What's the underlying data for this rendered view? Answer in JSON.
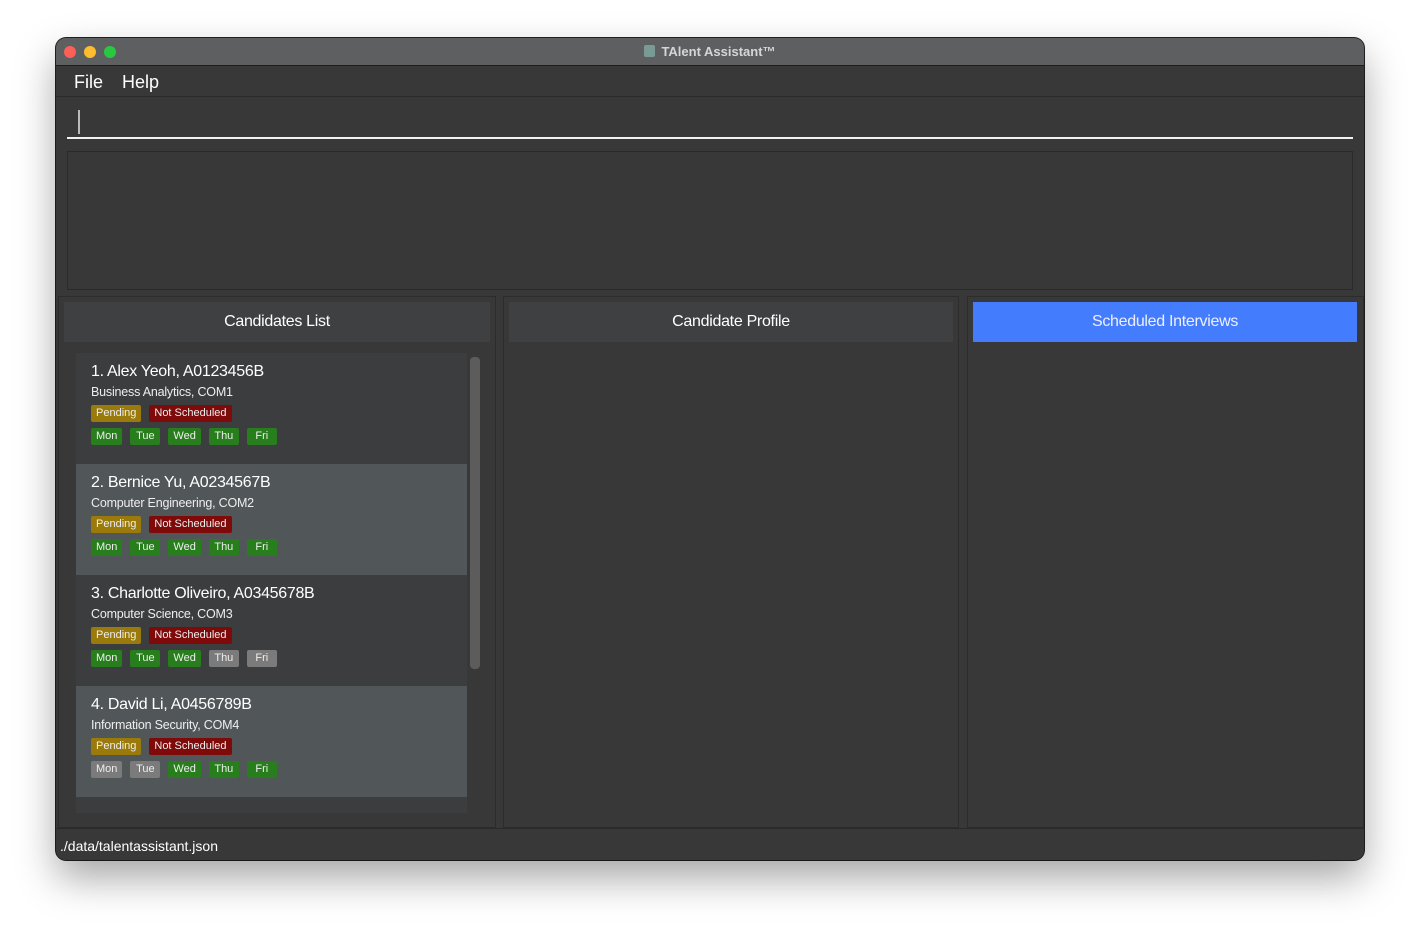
{
  "window": {
    "title": "TAlent Assistant™",
    "title_icon": "calendar-icon"
  },
  "menu": {
    "file": "File",
    "help": "Help"
  },
  "command": {
    "value": ""
  },
  "panels": {
    "candidates": "Candidates List",
    "profile": "Candidate Profile",
    "interviews": "Scheduled Interviews"
  },
  "colors": {
    "accent": "#437dfe",
    "pending": "#9a7a0a",
    "not_scheduled": "#7e0a0a",
    "available": "#287d1d",
    "unavailable": "#7b7b7b"
  },
  "candidates": [
    {
      "title": "1.  Alex Yeoh, A0123456B",
      "subtitle": "Business Analytics, COM1",
      "status": "Pending",
      "interview": "Not Scheduled",
      "days": [
        {
          "label": "Mon",
          "available": true
        },
        {
          "label": "Tue",
          "available": true
        },
        {
          "label": "Wed",
          "available": true
        },
        {
          "label": "Thu",
          "available": true
        },
        {
          "label": "Fri",
          "available": true
        }
      ]
    },
    {
      "title": "2.  Bernice Yu, A0234567B",
      "subtitle": "Computer Engineering, COM2",
      "status": "Pending",
      "interview": "Not Scheduled",
      "days": [
        {
          "label": "Mon",
          "available": true
        },
        {
          "label": "Tue",
          "available": true
        },
        {
          "label": "Wed",
          "available": true
        },
        {
          "label": "Thu",
          "available": true
        },
        {
          "label": "Fri",
          "available": true
        }
      ]
    },
    {
      "title": "3.  Charlotte Oliveiro, A0345678B",
      "subtitle": "Computer Science, COM3",
      "status": "Pending",
      "interview": "Not Scheduled",
      "days": [
        {
          "label": "Mon",
          "available": true
        },
        {
          "label": "Tue",
          "available": true
        },
        {
          "label": "Wed",
          "available": true
        },
        {
          "label": "Thu",
          "available": false
        },
        {
          "label": "Fri",
          "available": false
        }
      ]
    },
    {
      "title": "4.  David Li, A0456789B",
      "subtitle": "Information Security, COM4",
      "status": "Pending",
      "interview": "Not Scheduled",
      "days": [
        {
          "label": "Mon",
          "available": false
        },
        {
          "label": "Tue",
          "available": false
        },
        {
          "label": "Wed",
          "available": true
        },
        {
          "label": "Thu",
          "available": true
        },
        {
          "label": "Fri",
          "available": true
        }
      ]
    }
  ],
  "status_bar": {
    "path": "./data/talentassistant.json"
  }
}
